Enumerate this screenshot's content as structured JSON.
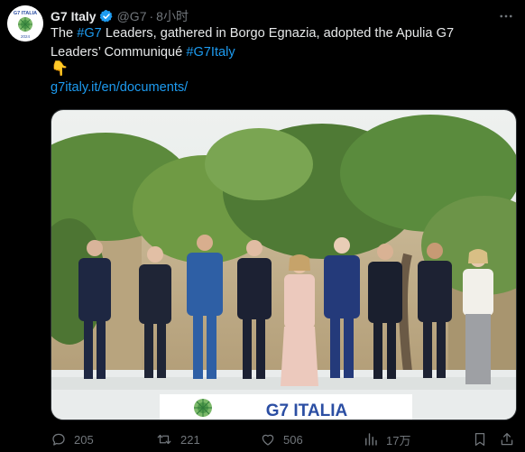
{
  "tweet": {
    "display_name": "G7 Italy",
    "handle": "@G7",
    "dot": "·",
    "time": "8小时",
    "text_parts": {
      "p1": "The ",
      "tag1": "#G7",
      "p2": " Leaders, gathered in Borgo Egnazia, adopted the Apulia G7 Leaders’ Communiqué ",
      "tag2": "#G7Italy"
    },
    "emoji": "👇",
    "link": "g7italy.it/en/documents/"
  },
  "avatar": {
    "top_text": "G7 ITALIA",
    "bottom_text": "2024"
  },
  "photo": {
    "banner_text": "G7 ITALIA"
  },
  "actions": {
    "reply_count": "205",
    "retweet_count": "221",
    "like_count": "506",
    "views_count": "17万"
  },
  "colors": {
    "accent": "#1d9bf0",
    "muted": "#71767b",
    "text": "#e7e9ea",
    "background": "#000000"
  },
  "icons": [
    "verified-badge-icon",
    "more-icon",
    "reply-icon",
    "retweet-icon",
    "like-icon",
    "views-icon",
    "bookmark-icon",
    "share-icon"
  ]
}
